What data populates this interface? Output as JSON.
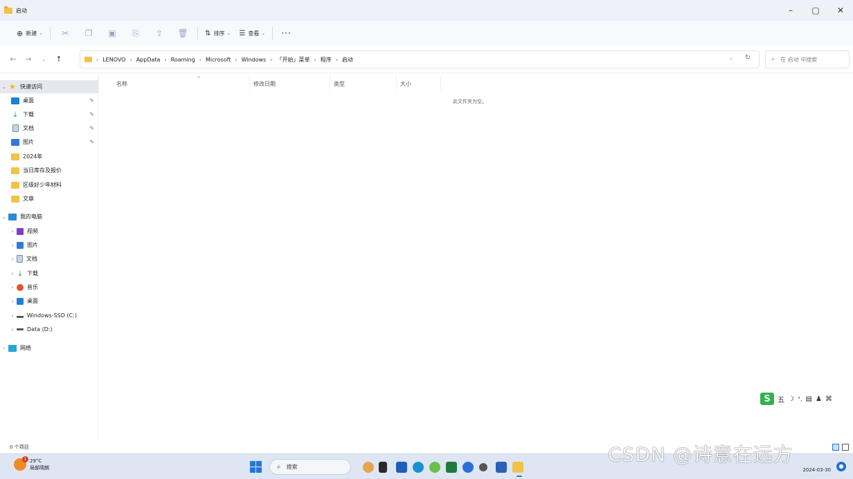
{
  "window": {
    "title": "启动",
    "minimize": "–",
    "maximize": "▢",
    "close": "✕"
  },
  "toolbar": {
    "new_label": "新建",
    "sort_label": "排序",
    "view_label": "查看",
    "more": "···"
  },
  "address": {
    "crumbs": [
      "LENOVO",
      "AppData",
      "Roaming",
      "Microsoft",
      "Windows",
      "「开始」菜单",
      "程序",
      "启动"
    ],
    "search_placeholder": "在 启动 中搜索"
  },
  "sidebar": {
    "quick_access": "快速访问",
    "quick_items": [
      "桌面",
      "下载",
      "文档",
      "图片",
      "2024年",
      "当日库存及报价",
      "区级好少年材料",
      "文章"
    ],
    "this_pc": "我的电脑",
    "pc_items": [
      "视频",
      "图片",
      "文档",
      "下载",
      "音乐",
      "桌面",
      "Windows-SSD (C:)",
      "Data (D:)"
    ],
    "network": "网络"
  },
  "columns": {
    "name": "名称",
    "modified": "修改日期",
    "type": "类型",
    "size": "大小"
  },
  "empty_message": "此文件夹为空。",
  "ime": {
    "logo": "S",
    "mode": "五"
  },
  "status": {
    "count": "0 个项目"
  },
  "taskbar": {
    "temp": "29°C",
    "weather": "局部晴朗",
    "badge": "1",
    "search": "搜索",
    "date": "2024-03-30"
  },
  "watermark": "CSDN @诗意在远方",
  "colors": {
    "accent": "#2278d6",
    "folder": "#f3c24a"
  }
}
